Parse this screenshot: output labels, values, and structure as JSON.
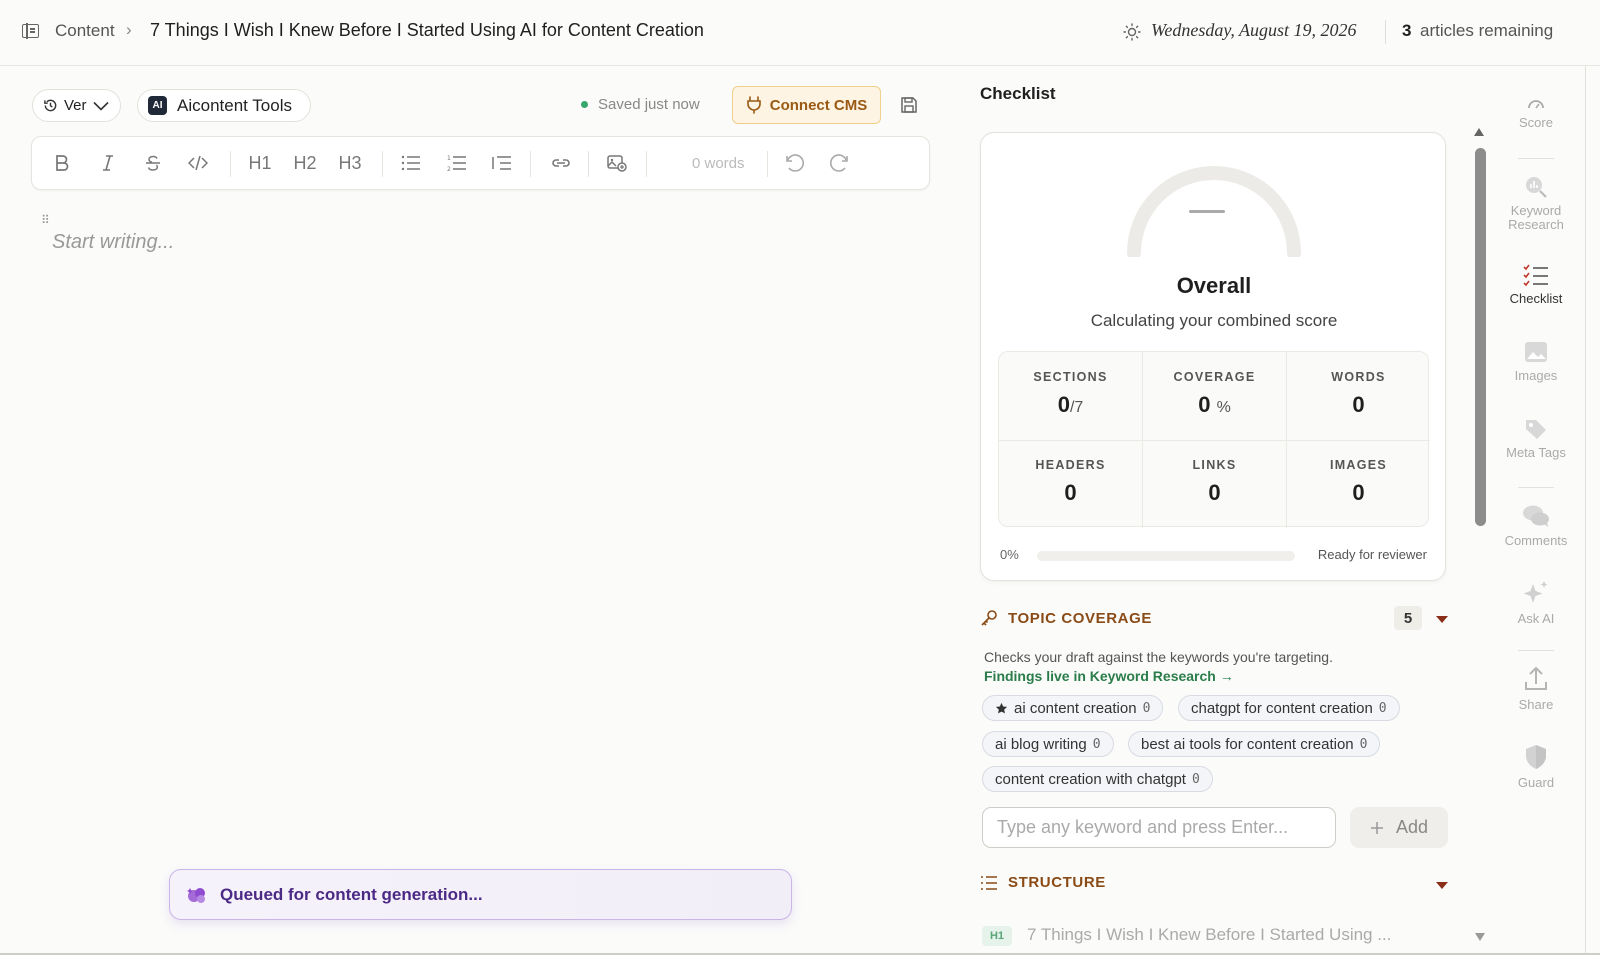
{
  "topbar": {
    "breadcrumb_root": "Content",
    "breadcrumb_sep": ">",
    "article_title": "7 Things I Wish I Knew Before I Started Using AI for Content Creation",
    "date": "Wednesday, August 19, 2026",
    "articles_count": "3",
    "articles_label": "articles remaining"
  },
  "editor": {
    "version_label": "Ver",
    "brand_logo_text": "AI",
    "brand_label": "Aicontent Tools",
    "saved_status": "Saved just now",
    "connect_cms_label": "Connect CMS",
    "toolbar": {
      "h1": "H1",
      "h2": "H2",
      "h3": "H3",
      "word_count": "0 words"
    },
    "placeholder": "Start writing..."
  },
  "toast": {
    "message": "Queued for content generation..."
  },
  "checklist": {
    "title": "Checklist",
    "score_display": "—",
    "overall_title": "Overall",
    "overall_sub": "Calculating your combined score",
    "stats": [
      {
        "label": "SECTIONS",
        "value": "0",
        "unit": "/7"
      },
      {
        "label": "COVERAGE",
        "value": "0",
        "unit": "%"
      },
      {
        "label": "WORDS",
        "value": "0",
        "unit": ""
      },
      {
        "label": "HEADERS",
        "value": "0",
        "unit": ""
      },
      {
        "label": "LINKS",
        "value": "0",
        "unit": ""
      },
      {
        "label": "IMAGES",
        "value": "0",
        "unit": ""
      }
    ],
    "progress_pct": "0%",
    "progress_value": 0,
    "progress_label": "Ready for reviewer"
  },
  "topic_coverage": {
    "title": "TOPIC COVERAGE",
    "count": "5",
    "description": "Checks your draft against the keywords you're targeting.",
    "link": "Findings live in Keyword Research →",
    "keywords": [
      {
        "text": "ai content creation",
        "count": "0",
        "starred": true
      },
      {
        "text": "chatgpt for content creation",
        "count": "0",
        "starred": false
      },
      {
        "text": "ai blog writing",
        "count": "0",
        "starred": false
      },
      {
        "text": "best ai tools for content creation",
        "count": "0",
        "starred": false
      },
      {
        "text": "content creation with chatgpt",
        "count": "0",
        "starred": false
      }
    ],
    "input_placeholder": "Type any keyword and press Enter...",
    "add_label": "Add"
  },
  "structure": {
    "title": "STRUCTURE",
    "first_heading_tag": "H1",
    "first_heading_text": "7 Things I Wish I Knew Before I Started Using ..."
  },
  "rail": {
    "score": "Score",
    "keyword_research": "Keyword Research",
    "checklist": "Checklist",
    "images": "Images",
    "meta_tags": "Meta Tags",
    "comments": "Comments",
    "ask_ai": "Ask AI",
    "share": "Share",
    "guard": "Guard"
  },
  "colors": {
    "accent_orange": "#8a4b16",
    "success_green": "#36a66b",
    "toast_purple": "#4b2a85",
    "cms_amber": "#fdf4e3"
  }
}
